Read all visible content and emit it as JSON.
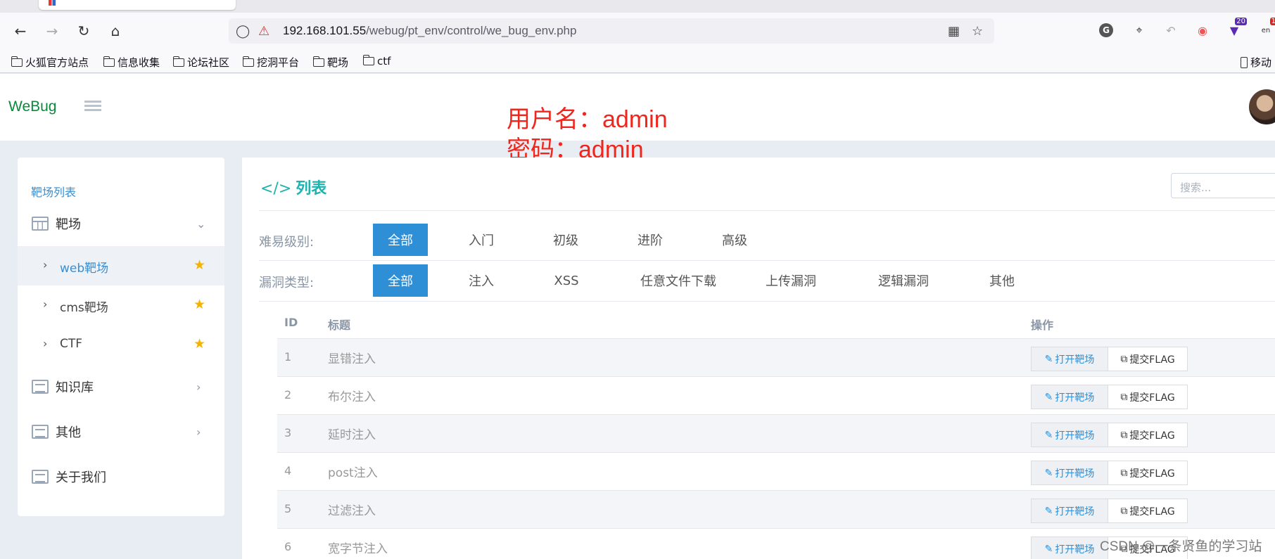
{
  "browser": {
    "url_host": "192.168.101.55",
    "url_path": "/webug/pt_env/control/we_bug_env.php",
    "ext_badge_1": "20",
    "ext_badge_2": "1",
    "ext_label_en": "en",
    "bookmarks": [
      "火狐官方站点",
      "信息收集",
      "论坛社区",
      "挖洞平台",
      "靶场",
      "ctf"
    ],
    "mobile_bookmarks": "移动"
  },
  "app": {
    "brand": "WeBug",
    "annotation": {
      "line1": "用户名：admin",
      "line2": "密码：admin"
    }
  },
  "sidebar": {
    "heading": "靶场列表",
    "group_label": "靶场",
    "sub_items": [
      {
        "label": "web靶场",
        "active": true
      },
      {
        "label": "cms靶场",
        "active": false
      },
      {
        "label": "CTF",
        "active": false
      }
    ],
    "items": [
      {
        "label": "知识库"
      },
      {
        "label": "其他"
      },
      {
        "label": "关于我们"
      }
    ]
  },
  "main": {
    "title": "列表",
    "search_placeholder": "搜索...",
    "difficulty": {
      "label": "难易级别:",
      "options": [
        "全部",
        "入门",
        "初级",
        "进阶",
        "高级"
      ],
      "selected": "全部"
    },
    "vuln_type": {
      "label": "漏洞类型:",
      "options": [
        "全部",
        "注入",
        "XSS",
        "任意文件下载",
        "上传漏洞",
        "逻辑漏洞",
        "其他"
      ],
      "selected": "全部"
    },
    "table": {
      "headers": {
        "id": "ID",
        "title": "标题",
        "action": "操作"
      },
      "open_label": "打开靶场",
      "submit_label": "提交FLAG",
      "rows": [
        {
          "id": "1",
          "title": "显错注入"
        },
        {
          "id": "2",
          "title": "布尔注入"
        },
        {
          "id": "3",
          "title": "延时注入"
        },
        {
          "id": "4",
          "title": "post注入"
        },
        {
          "id": "5",
          "title": "过滤注入"
        },
        {
          "id": "6",
          "title": "宽字节注入"
        }
      ]
    }
  },
  "watermark": "CSDN @一条贤鱼的学习站",
  "colors": {
    "brand": "#0a8a3a",
    "primary": "#2e8fd6",
    "title": "#1fb3b0",
    "annotation": "#f0261c",
    "star": "#f5b301"
  }
}
